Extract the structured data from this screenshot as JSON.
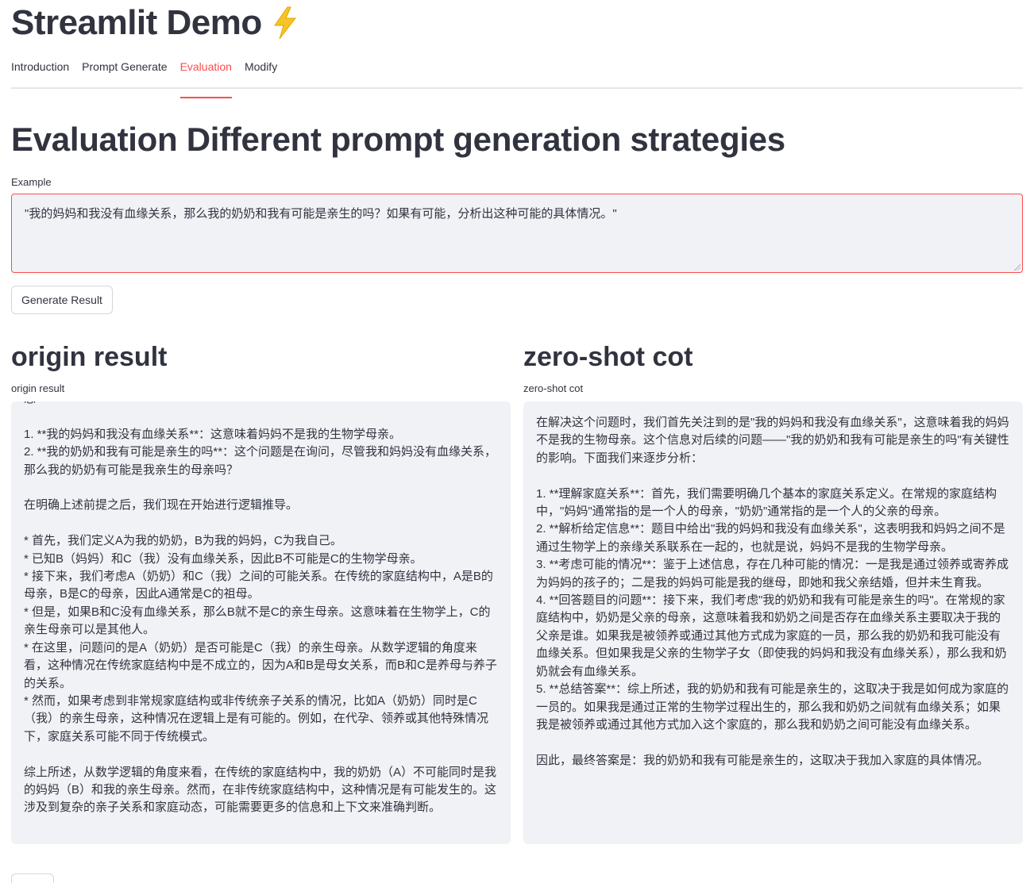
{
  "app": {
    "title": "Streamlit Demo",
    "title_icon": "lightning-bolt-icon"
  },
  "tabs": [
    {
      "label": "Introduction"
    },
    {
      "label": "Prompt Generate"
    },
    {
      "label": "Evaluation",
      "active": true
    },
    {
      "label": "Modify"
    }
  ],
  "main": {
    "heading": "Evaluation Different prompt generation strategies",
    "example_label": "Example",
    "example_value": "\"我的妈妈和我没有血缘关系，那么我的奶奶和我有可能是亲生的吗？如果有可能，分析出这种可能的具体情况。\"",
    "generate_button": "Generate Result"
  },
  "results": {
    "origin": {
      "heading": "origin result",
      "label": "origin result",
      "text": "思\n\n1. **我的妈妈和我没有血缘关系**：这意味着妈妈不是我的生物学母亲。\n2. **我的奶奶和我有可能是亲生的吗**：这个问题是在询问，尽管我和妈妈没有血缘关系，那么我的奶奶有可能是我亲生的母亲吗？\n\n在明确上述前提之后，我们现在开始进行逻辑推导。\n\n* 首先，我们定义A为我的奶奶，B为我的妈妈，C为我自己。\n* 已知B（妈妈）和C（我）没有血缘关系，因此B不可能是C的生物学母亲。\n* 接下来，我们考虑A（奶奶）和C（我）之间的可能关系。在传统的家庭结构中，A是B的母亲，B是C的母亲，因此A通常是C的祖母。\n* 但是，如果B和C没有血缘关系，那么B就不是C的亲生母亲。这意味着在生物学上，C的亲生母亲可以是其他人。\n* 在这里，问题问的是A（奶奶）是否可能是C（我）的亲生母亲。从数学逻辑的角度来看，这种情况在传统家庭结构中是不成立的，因为A和B是母女关系，而B和C是养母与养子的关系。\n* 然而，如果考虑到非常规家庭结构或非传统亲子关系的情况，比如A（奶奶）同时是C（我）的亲生母亲，这种情况在逻辑上是有可能的。例如，在代孕、领养或其他特殊情况下，家庭关系可能不同于传统模式。\n\n综上所述，从数学逻辑的角度来看，在传统的家庭结构中，我的奶奶（A）不可能同时是我的妈妈（B）和我的亲生母亲。然而，在非传统家庭结构中，这种情况是有可能发生的。这涉及到复杂的亲子关系和家庭动态，可能需要更多的信息和上下文来准确判断。"
    },
    "zeroshot": {
      "heading": "zero-shot cot",
      "label": "zero-shot cot",
      "text": "在解决这个问题时，我们首先关注到的是\"我的妈妈和我没有血缘关系\"，这意味着我的妈妈不是我的生物母亲。这个信息对后续的问题——\"我的奶奶和我有可能是亲生的吗\"有关键性的影响。下面我们来逐步分析：\n\n1. **理解家庭关系**：首先，我们需要明确几个基本的家庭关系定义。在常规的家庭结构中，\"妈妈\"通常指的是一个人的母亲，\"奶奶\"通常指的是一个人的父亲的母亲。\n2. **解析给定信息**：题目中给出\"我的妈妈和我没有血缘关系\"，这表明我和妈妈之间不是通过生物学上的亲缘关系联系在一起的，也就是说，妈妈不是我的生物学母亲。\n3. **考虑可能的情况**：鉴于上述信息，存在几种可能的情况：一是我是通过领养或寄养成为妈妈的孩子的；二是我的妈妈可能是我的继母，即她和我父亲结婚，但并未生育我。\n4. **回答题目的问题**：接下来，我们考虑\"我的奶奶和我有可能是亲生的吗\"。在常规的家庭结构中，奶奶是父亲的母亲，这意味着我和奶奶之间是否存在血缘关系主要取决于我的父亲是谁。如果我是被领养或通过其他方式成为家庭的一员，那么我的奶奶和我可能没有血缘关系。但如果我是父亲的生物学子女（即使我的妈妈和我没有血缘关系），那么我和奶奶就会有血缘关系。\n5. **总结答案**：综上所述，我的奶奶和我有可能是亲生的，这取决于我是如何成为家庭的一员的。如果我是通过正常的生物学过程出生的，那么我和奶奶之间就有血缘关系；如果我是被领养或通过其他方式加入这个家庭的，那么我和奶奶之间可能没有血缘关系。\n\n因此，最终答案是：我的奶奶和我有可能是亲生的，这取决于我加入家庭的具体情况。"
    }
  },
  "colors": {
    "accent": "#ff4b4b",
    "text": "#31333F",
    "field_bg": "#f0f2f6"
  }
}
